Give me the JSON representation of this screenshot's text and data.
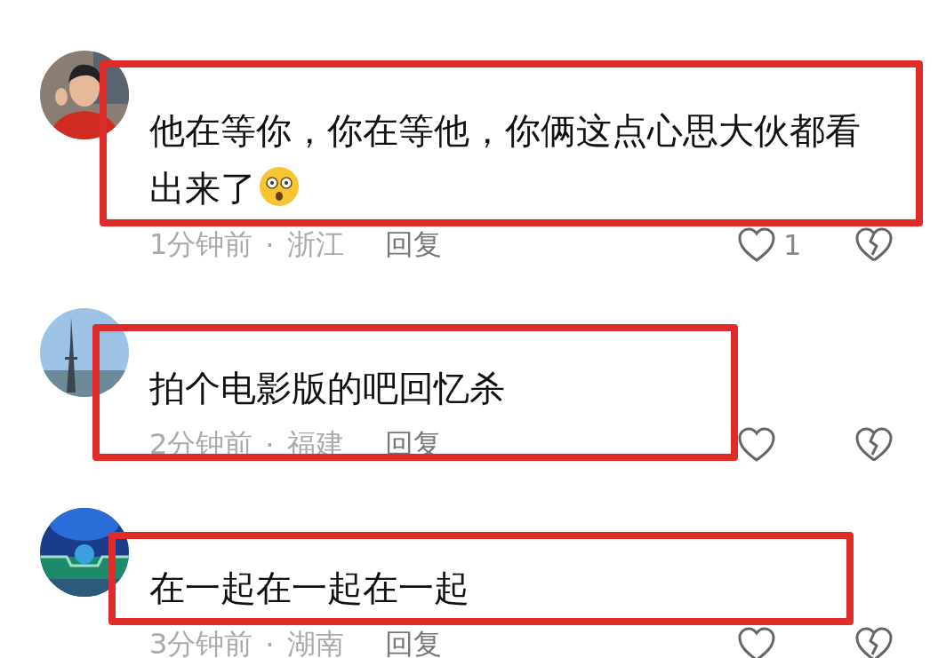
{
  "comments": [
    {
      "avatar": {
        "kind": "picture"
      },
      "lines": [
        "他在等你，你在等他，你俩这点心思大伙都看",
        "出来了"
      ],
      "emoji_after": true,
      "time": "1分钟前",
      "separator": "·",
      "location": "浙江",
      "reply": "回复",
      "likes": "1",
      "highlighted": true
    },
    {
      "avatar": {
        "kind": "picture"
      },
      "lines": [
        "拍个电影版的吧回忆杀"
      ],
      "emoji_after": false,
      "time": "2分钟前",
      "separator": "·",
      "location": "福建",
      "reply": "回复",
      "highlighted": true
    },
    {
      "avatar": {
        "kind": "picture"
      },
      "lines": [
        "在一起在一起在一起"
      ],
      "emoji_after": false,
      "time": "3分钟前",
      "separator": "·",
      "location": "湖南",
      "reply": "回复",
      "highlighted": true
    }
  ]
}
